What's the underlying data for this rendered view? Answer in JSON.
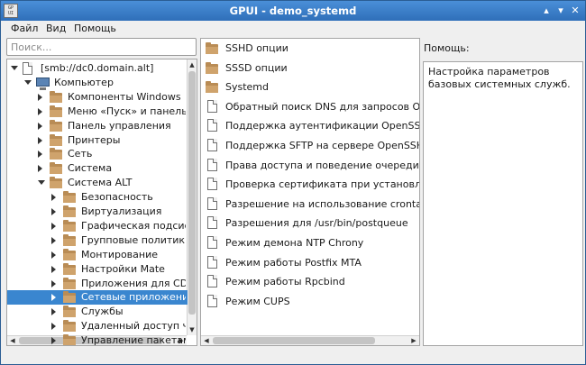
{
  "window": {
    "title": "GPUI - demo_systemd",
    "app_icon_text": [
      "GP",
      "UI"
    ],
    "controls": [
      "▴",
      "▾",
      "✕"
    ]
  },
  "menu": [
    "Файл",
    "Вид",
    "Помощь"
  ],
  "search": {
    "placeholder": "Поиск..."
  },
  "tree": {
    "selected_index": 16,
    "items": [
      {
        "label": "[smb://dc0.domain.alt]",
        "level": 0,
        "expanded": true,
        "icon": "document-icon"
      },
      {
        "label": "Компьютер",
        "level": 1,
        "expanded": true,
        "icon": "computer-icon"
      },
      {
        "label": "Компоненты Windows",
        "level": 2,
        "expanded": false,
        "icon": "folder-icon"
      },
      {
        "label": "Меню «Пуск» и панель",
        "level": 2,
        "expanded": false,
        "icon": "folder-icon"
      },
      {
        "label": "Панель управления",
        "level": 2,
        "expanded": false,
        "icon": "folder-icon"
      },
      {
        "label": "Принтеры",
        "level": 2,
        "expanded": false,
        "icon": "folder-icon"
      },
      {
        "label": "Сеть",
        "level": 2,
        "expanded": false,
        "icon": "folder-icon"
      },
      {
        "label": "Система",
        "level": 2,
        "expanded": false,
        "icon": "folder-icon"
      },
      {
        "label": "Система ALT",
        "level": 2,
        "expanded": true,
        "icon": "folder-icon"
      },
      {
        "label": "Безопасность",
        "level": 3,
        "expanded": false,
        "icon": "folder-icon"
      },
      {
        "label": "Виртуализация",
        "level": 3,
        "expanded": false,
        "icon": "folder-icon"
      },
      {
        "label": "Графическая подсис",
        "level": 3,
        "expanded": false,
        "icon": "folder-icon"
      },
      {
        "label": "Групповые политики",
        "level": 3,
        "expanded": false,
        "icon": "folder-icon"
      },
      {
        "label": "Монтирование",
        "level": 3,
        "expanded": false,
        "icon": "folder-icon"
      },
      {
        "label": "Настройки Mate",
        "level": 3,
        "expanded": false,
        "icon": "folder-icon"
      },
      {
        "label": "Приложения для CD",
        "level": 3,
        "expanded": false,
        "icon": "folder-icon"
      },
      {
        "label": "Сетевые приложения",
        "level": 3,
        "expanded": false,
        "icon": "folder-icon"
      },
      {
        "label": "Службы",
        "level": 3,
        "expanded": false,
        "icon": "folder-icon"
      },
      {
        "label": "Удаленный доступ ч",
        "level": 3,
        "expanded": false,
        "icon": "folder-icon"
      },
      {
        "label": "Управление пакетами",
        "level": 3,
        "expanded": false,
        "icon": "folder-icon"
      }
    ]
  },
  "list": {
    "items": [
      {
        "label": "SSHD опции",
        "icon": "folder-icon"
      },
      {
        "label": "SSSD опции",
        "icon": "folder-icon"
      },
      {
        "label": "Systemd",
        "icon": "folder-icon"
      },
      {
        "label": "Обратный поиск DNS для запросов OpenLDA",
        "icon": "document-icon"
      },
      {
        "label": "Поддержка аутентификации OpenSSH-клие",
        "icon": "document-icon"
      },
      {
        "label": "Поддержка SFTP на сервере OpenSSH",
        "icon": "document-icon"
      },
      {
        "label": "Права доступа и поведение очереди задани",
        "icon": "document-icon"
      },
      {
        "label": "Проверка сертификата при установлении с",
        "icon": "document-icon"
      },
      {
        "label": "Разрешение на использование crontab",
        "icon": "document-icon"
      },
      {
        "label": "Разрешения для /usr/bin/postqueue",
        "icon": "document-icon"
      },
      {
        "label": "Режим демона NTP Chrony",
        "icon": "document-icon"
      },
      {
        "label": "Режим работы Postfix MTA",
        "icon": "document-icon"
      },
      {
        "label": "Режим работы Rpcbind",
        "icon": "document-icon"
      },
      {
        "label": "Режим CUPS",
        "icon": "document-icon"
      }
    ]
  },
  "help": {
    "label": "Помощь:",
    "text": "Настройка параметров базовых системных служб."
  },
  "colors": {
    "titlebar": "#2f6fb9",
    "selection": "#3a86cf",
    "folder": "#cfa36c"
  }
}
